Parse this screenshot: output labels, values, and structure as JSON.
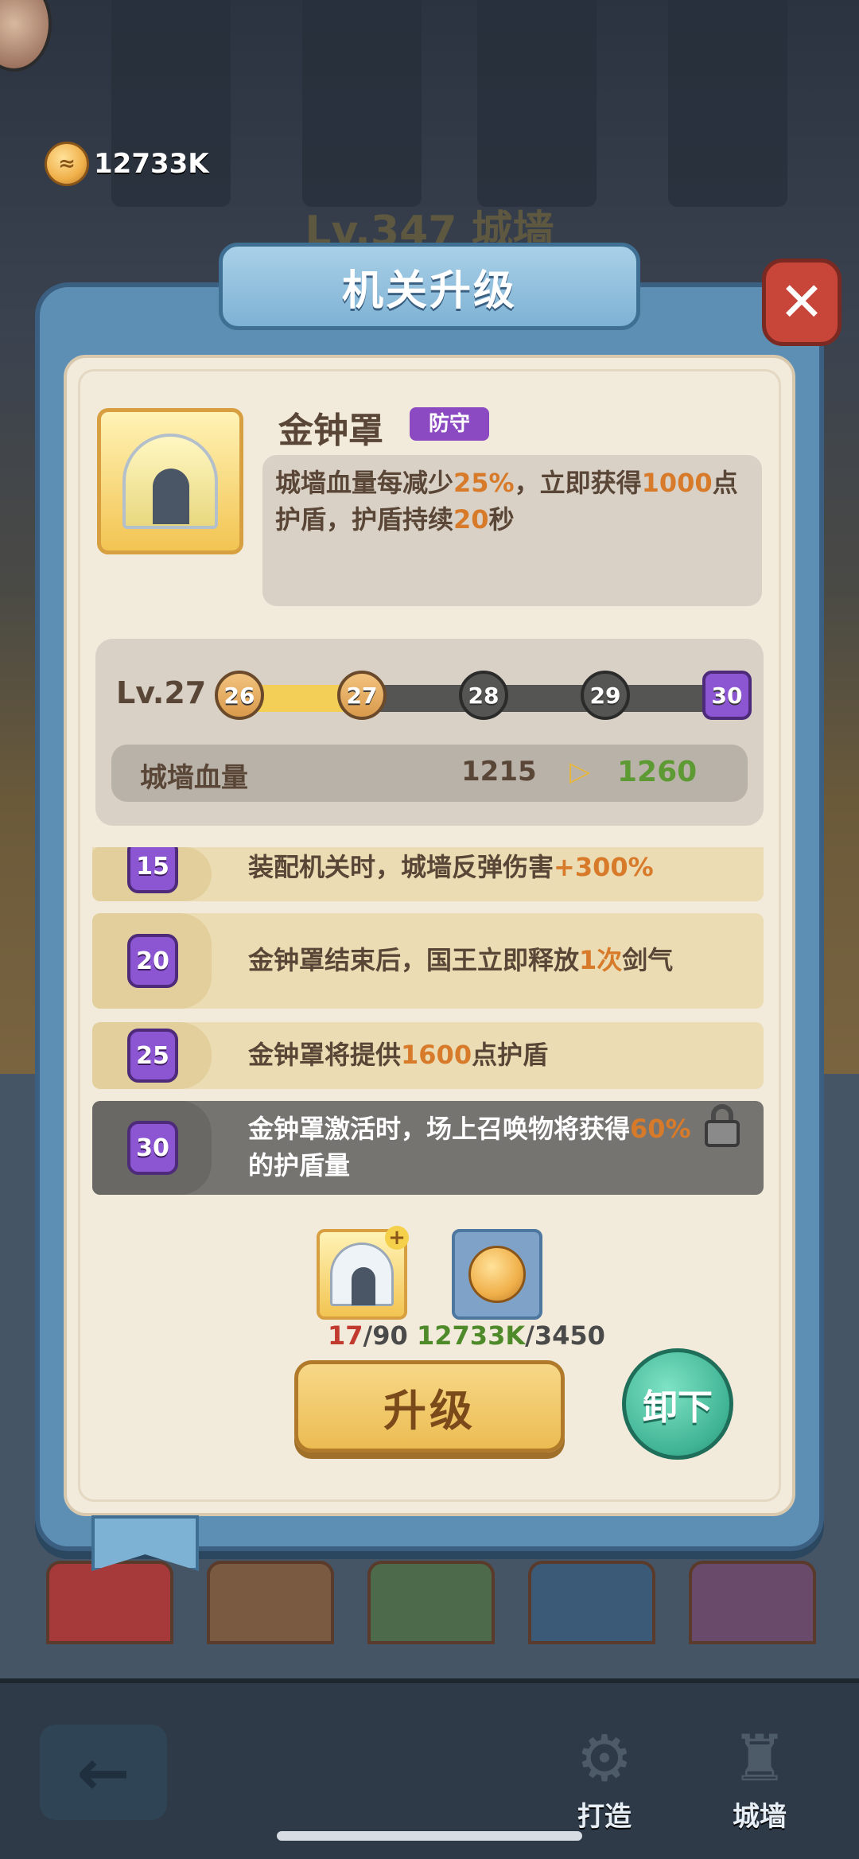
{
  "hud": {
    "currency": "12733K",
    "bg_title": "Lv.347 城墙"
  },
  "dialog": {
    "title": "机关升级",
    "close_label": "✕"
  },
  "item": {
    "name": "金钟罩",
    "tag": "防守",
    "desc_parts": [
      "城墙血量每减少",
      "25%",
      "，立即获得",
      "1000",
      "点护盾，护盾持续",
      "20",
      "秒"
    ]
  },
  "level": {
    "label": "Lv.27",
    "current": 27,
    "nodes": [
      "26",
      "27",
      "28",
      "29",
      "30"
    ],
    "progress_fraction": 0.25
  },
  "stat": {
    "label": "城墙血量",
    "current": "1215",
    "next": "1260"
  },
  "perks": [
    {
      "level": "15",
      "text_parts": [
        "装配机关时，城墙反弹伤害",
        "+300%",
        ""
      ],
      "locked": false
    },
    {
      "level": "20",
      "text_parts": [
        "金钟罩结束后，国王立即释放",
        "1次",
        "剑气"
      ],
      "locked": false
    },
    {
      "level": "25",
      "text_parts": [
        "金钟罩将提供",
        "1600",
        "点护盾"
      ],
      "locked": false
    },
    {
      "level": "30",
      "text_parts": [
        "金钟罩激活时，场上召唤物将获得",
        "60%",
        "的护盾量"
      ],
      "locked": true
    }
  ],
  "costs": {
    "item_have": "17",
    "item_need": "/90",
    "coin_have": "12733K",
    "coin_need": "/3450"
  },
  "buttons": {
    "upgrade": "升级",
    "unequip": "卸下"
  },
  "nav": {
    "back_icon": "←",
    "forge_label": "打造",
    "wall_label": "城墙"
  },
  "colors": {
    "highlight": "#d77a2a",
    "perk_badge": "#8c55d2",
    "next_value": "#5e9a34"
  }
}
